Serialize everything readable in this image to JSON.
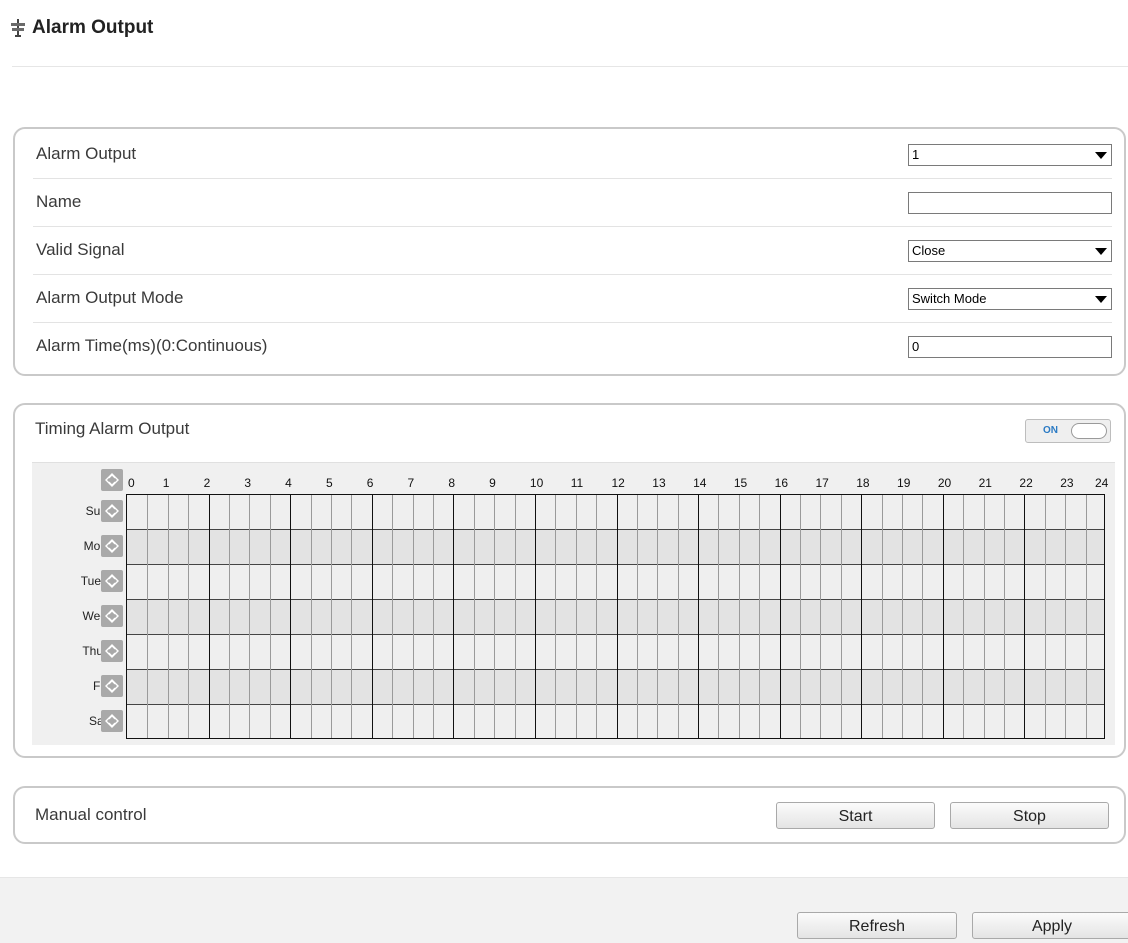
{
  "page": {
    "title": "Alarm Output",
    "title_icon": "alarm-output-icon"
  },
  "settings": {
    "rows": [
      {
        "label": "Alarm Output",
        "type": "select",
        "value": "1"
      },
      {
        "label": "Name",
        "type": "text",
        "value": ""
      },
      {
        "label": "Valid Signal",
        "type": "select",
        "value": "Close"
      },
      {
        "label": "Alarm Output Mode",
        "type": "select",
        "value": "Switch Mode"
      },
      {
        "label": "Alarm Time(ms)(0:Continuous)",
        "type": "text",
        "value": "0"
      }
    ]
  },
  "timing": {
    "title": "Timing Alarm Output",
    "toggle_label": "ON",
    "enabled": true,
    "days": [
      "Sun",
      "Mon",
      "Tues",
      "Wed",
      "Thur",
      "Fri",
      "Sat"
    ],
    "hours": [
      "0",
      "1",
      "2",
      "3",
      "4",
      "5",
      "6",
      "7",
      "8",
      "9",
      "10",
      "11",
      "12",
      "13",
      "14",
      "15",
      "16",
      "17",
      "18",
      "19",
      "20",
      "21",
      "22",
      "23",
      "24"
    ],
    "copy_icon": "copy-schedule-icon"
  },
  "manual": {
    "label": "Manual control",
    "start_label": "Start",
    "stop_label": "Stop"
  },
  "footer": {
    "refresh_label": "Refresh",
    "apply_label": "Apply"
  },
  "colors": {
    "panel_border": "#c9c9c9",
    "grid_bg": "#efefef",
    "toggle_on_text": "#2a7ac4"
  }
}
